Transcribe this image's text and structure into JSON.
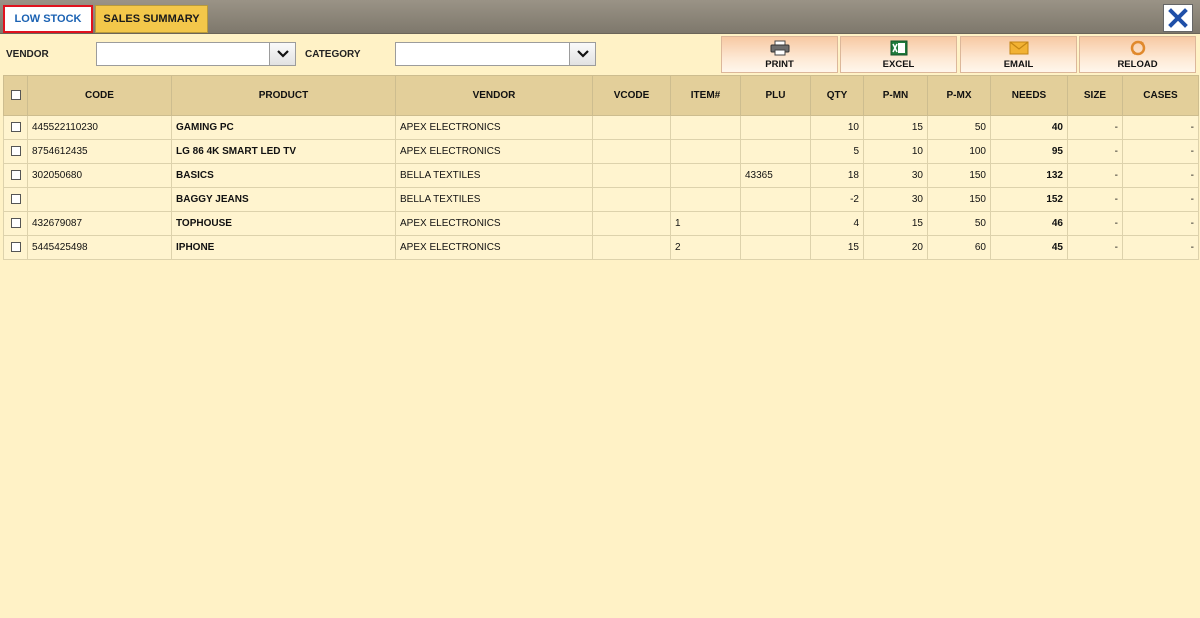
{
  "tabs": {
    "low_stock": "LOW STOCK",
    "sales_summary": "SALES SUMMARY"
  },
  "filters": {
    "vendor_label": "VENDOR",
    "vendor_value": "",
    "category_label": "CATEGORY",
    "category_value": ""
  },
  "toolbar": {
    "print": "PRINT",
    "excel": "EXCEL",
    "email": "EMAIL",
    "reload": "RELOAD"
  },
  "table": {
    "headers": {
      "code": "CODE",
      "product": "PRODUCT",
      "vendor": "VENDOR",
      "vcode": "VCODE",
      "item": "ITEM#",
      "plu": "PLU",
      "qty": "QTY",
      "pmn": "P-MN",
      "pmx": "P-MX",
      "needs": "NEEDS",
      "size": "SIZE",
      "cases": "CASES"
    },
    "rows": [
      {
        "code": "445522110230",
        "product": "GAMING PC",
        "vendor": "APEX ELECTRONICS",
        "vcode": "",
        "item": "",
        "plu": "",
        "qty": "10",
        "pmn": "15",
        "pmx": "50",
        "needs": "40",
        "size": "-",
        "cases": "-"
      },
      {
        "code": "8754612435",
        "product": "LG 86 4K SMART LED TV",
        "vendor": "APEX ELECTRONICS",
        "vcode": "",
        "item": "",
        "plu": "",
        "qty": "5",
        "pmn": "10",
        "pmx": "100",
        "needs": "95",
        "size": "-",
        "cases": "-"
      },
      {
        "code": "302050680",
        "product": "BASICS",
        "vendor": "BELLA TEXTILES",
        "vcode": "",
        "item": "",
        "plu": "43365",
        "qty": "18",
        "pmn": "30",
        "pmx": "150",
        "needs": "132",
        "size": "-",
        "cases": "-"
      },
      {
        "code": "",
        "product": "BAGGY JEANS",
        "vendor": "BELLA TEXTILES",
        "vcode": "",
        "item": "",
        "plu": "",
        "qty": "-2",
        "pmn": "30",
        "pmx": "150",
        "needs": "152",
        "size": "-",
        "cases": "-"
      },
      {
        "code": "432679087",
        "product": "TOPHOUSE",
        "vendor": "APEX ELECTRONICS",
        "vcode": "",
        "item": "1",
        "plu": "",
        "qty": "4",
        "pmn": "15",
        "pmx": "50",
        "needs": "46",
        "size": "-",
        "cases": "-"
      },
      {
        "code": "5445425498",
        "product": "IPHONE",
        "vendor": "APEX ELECTRONICS",
        "vcode": "",
        "item": "2",
        "plu": "",
        "qty": "15",
        "pmn": "20",
        "pmx": "60",
        "needs": "45",
        "size": "-",
        "cases": "-"
      }
    ]
  },
  "colors": {
    "background": "#fff2c6",
    "header": "#e3cf9a",
    "active_tab_text": "#1b62b3",
    "active_tab_border": "#e0121d",
    "inactive_tab": "#f3c74a",
    "close_icon": "#1f4fa8"
  },
  "icons": {
    "close": "close-x-icon",
    "print": "printer-icon",
    "excel": "excel-icon",
    "email": "envelope-icon",
    "reload": "reload-icon"
  }
}
